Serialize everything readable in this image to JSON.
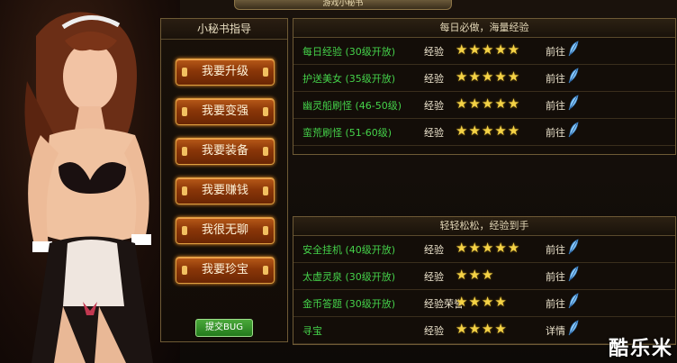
{
  "window": {
    "title": "游戏小秘书"
  },
  "guide": {
    "header": "小秘书指导",
    "buttons": [
      "我要升级",
      "我要变强",
      "我要装备",
      "我要赚钱",
      "我很无聊",
      "我要珍宝"
    ],
    "submit_bug": "提交BUG"
  },
  "daily": {
    "header": "每日必做，海量经验",
    "rows": [
      {
        "name": "每日经验 (30级开放)",
        "reward": "经验",
        "stars": 5,
        "action": "前往"
      },
      {
        "name": "护送美女 (35级开放)",
        "reward": "经验",
        "stars": 5,
        "action": "前往"
      },
      {
        "name": "幽灵船刷怪 (46-50级)",
        "reward": "经验",
        "stars": 5,
        "action": "前往"
      },
      {
        "name": "蛮荒刷怪 (51-60级)",
        "reward": "经验",
        "stars": 5,
        "action": "前往"
      }
    ]
  },
  "easy": {
    "header": "轻轻松松，经验到手",
    "rows": [
      {
        "name": "安全挂机 (40级开放)",
        "reward": "经验",
        "stars": 5,
        "action": "前往"
      },
      {
        "name": "太虚灵泉 (30级开放)",
        "reward": "经验",
        "stars": 3,
        "action": "前往"
      },
      {
        "name": "金币答题 (30级开放)",
        "reward": "经验荣誉",
        "stars": 4,
        "action": "前往"
      },
      {
        "name": "寻宝",
        "reward": "经验",
        "stars": 4,
        "action": "详情"
      }
    ]
  },
  "watermark": "酷乐米",
  "colors": {
    "task_name": "#45d24a",
    "star": "#f4d246",
    "button": "#8a3608"
  },
  "icons": {
    "task_action": "quill-feather-icon",
    "rating": "star-icon"
  }
}
